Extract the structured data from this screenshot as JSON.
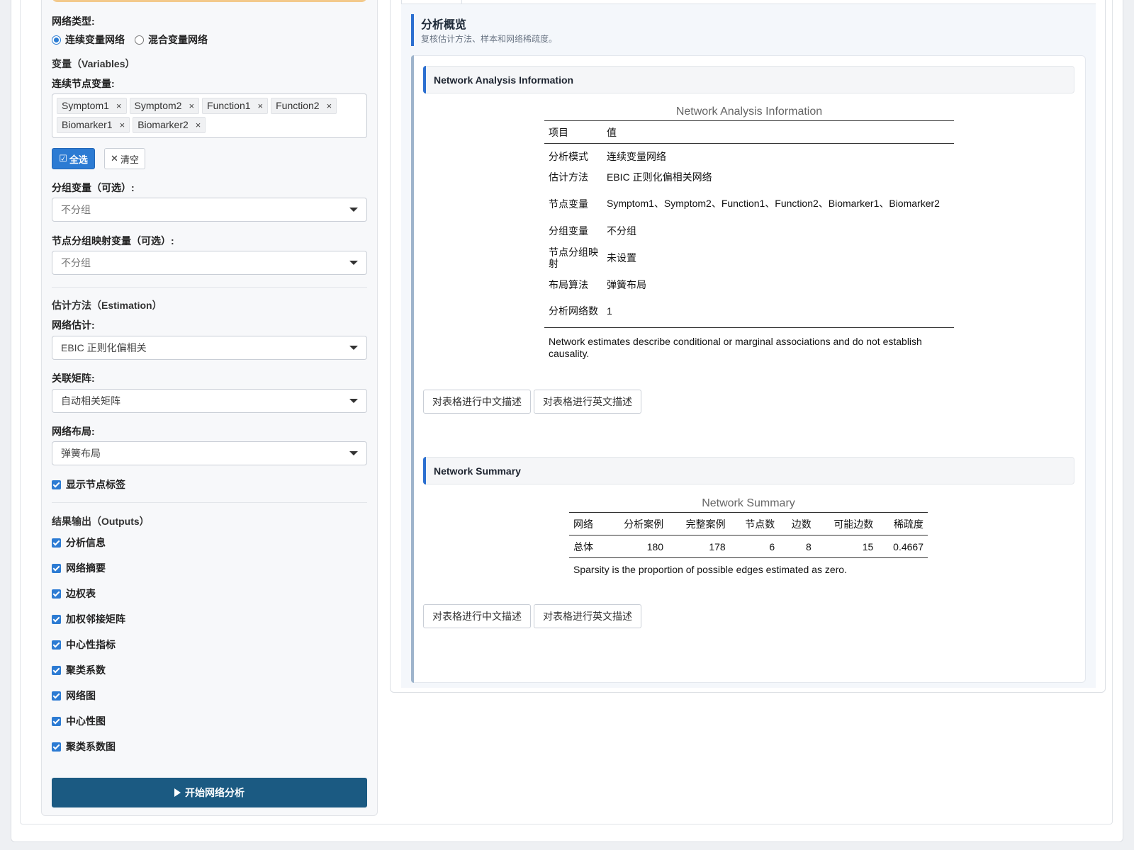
{
  "left": {
    "network_type_label": "网络类型:",
    "network_type_options": [
      "连续变量网络",
      "混合变量网络"
    ],
    "variables_title": "变量（Variables）",
    "continuous_nodes_label": "连续节点变量:",
    "continuous_nodes": [
      "Symptom1",
      "Symptom2",
      "Function1",
      "Function2",
      "Biomarker1",
      "Biomarker2"
    ],
    "select_all": "全选",
    "clear": "清空",
    "group_var_label": "分组变量（可选）:",
    "group_var_value": "不分组",
    "node_group_label": "节点分组映射变量（可选）:",
    "node_group_value": "不分组",
    "estimation_title": "估计方法（Estimation）",
    "network_est_label": "网络估计:",
    "network_est_value": "EBIC 正则化偏相关",
    "corr_matrix_label": "关联矩阵:",
    "corr_matrix_value": "自动相关矩阵",
    "layout_label": "网络布局:",
    "layout_value": "弹簧布局",
    "show_labels": "显示节点标签",
    "outputs_title": "结果输出（Outputs）",
    "outputs": [
      "分析信息",
      "网络摘要",
      "边权表",
      "加权邻接矩阵",
      "中心性指标",
      "聚类系数",
      "网络图",
      "中心性图",
      "聚类系数图"
    ],
    "run_button": "开始网络分析"
  },
  "right": {
    "overview_title": "分析概览",
    "overview_sub": "复核估计方法、样本和网络稀疏度。",
    "info_section": "Network Analysis Information",
    "info_caption": "Network Analysis Information",
    "info_headers": [
      "项目",
      "值"
    ],
    "info_rows": [
      [
        "分析模式",
        "连续变量网络"
      ],
      [
        "估计方法",
        "EBIC 正则化偏相关网络"
      ],
      [
        "节点变量",
        "Symptom1、Symptom2、Function1、Function2、Biomarker1、Biomarker2"
      ],
      [
        "分组变量",
        "不分组"
      ],
      [
        "节点分组映射",
        "未设置"
      ],
      [
        "布局算法",
        "弹簧布局"
      ],
      [
        "分析网络数",
        "1"
      ]
    ],
    "info_note": "Network estimates describe conditional or marginal associations and do not establish causality.",
    "desc_cn": "对表格进行中文描述",
    "desc_en": "对表格进行英文描述",
    "summary_section": "Network Summary",
    "summary_caption": "Network Summary",
    "summary_headers": [
      "网络",
      "分析案例",
      "完整案例",
      "节点数",
      "边数",
      "可能边数",
      "稀疏度"
    ],
    "summary_row": [
      "总体",
      "180",
      "178",
      "6",
      "8",
      "15",
      "0.4667"
    ],
    "summary_note": "Sparsity is the proportion of possible edges estimated as zero."
  }
}
